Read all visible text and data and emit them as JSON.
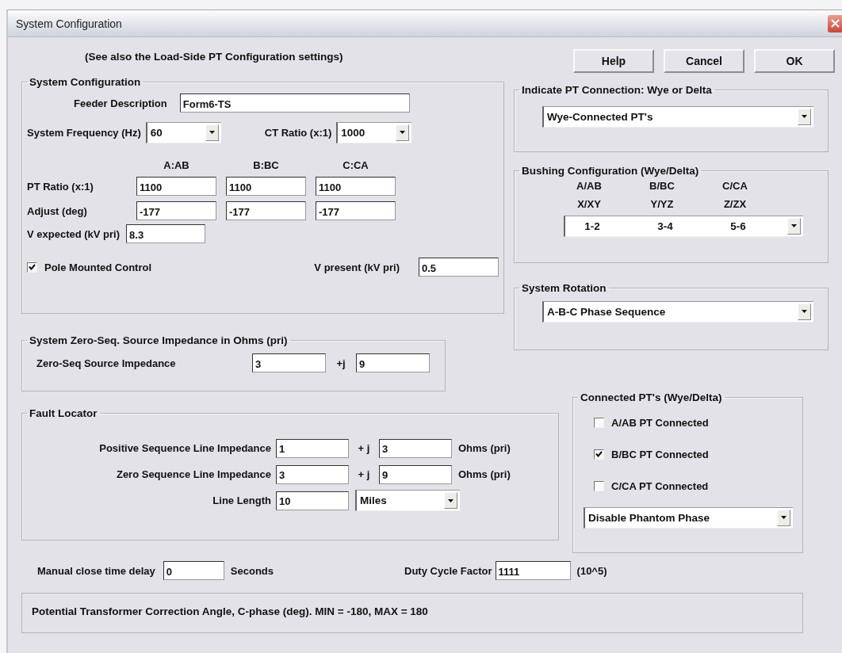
{
  "window": {
    "title": "System Configuration"
  },
  "note": "(See also the Load-Side PT Configuration settings)",
  "buttons": [
    "Help",
    "Cancel",
    "OK"
  ],
  "system_configuration": {
    "title": "System Configuration",
    "feeder_description": {
      "label": "Feeder Description",
      "value": "Form6-TS"
    },
    "system_frequency": {
      "label": "System Frequency (Hz)",
      "value": "60"
    },
    "ct_ratio": {
      "label": "CT Ratio (x:1)",
      "value": "1000"
    },
    "phase_columns": [
      "A:AB",
      "B:BC",
      "C:CA"
    ],
    "rows": [
      {
        "label": "PT Ratio (x:1)",
        "values": [
          "1100",
          "1100",
          "1100"
        ]
      },
      {
        "label": "Adjust (deg)",
        "values": [
          "-177",
          "-177",
          "-177"
        ]
      }
    ],
    "v_expected": {
      "label": "V expected (kV pri)",
      "value": "8.3"
    },
    "pole_mounted": {
      "label": "Pole Mounted Control",
      "checked": true
    },
    "v_present": {
      "label": "V present (kV pri)",
      "value": "0.5"
    }
  },
  "zero_seq_source": {
    "title": "System Zero-Seq. Source Impedance in Ohms (pri)",
    "label": "Zero-Seq Source Impedance",
    "real": "3",
    "imag_label": "+j",
    "imag": "9"
  },
  "fault_locator": {
    "title": "Fault Locator",
    "rows": [
      {
        "label": "Positive Sequence Line Impedance",
        "real": "1",
        "imag_label": "+ j",
        "imag": "3",
        "unit": "Ohms (pri)"
      },
      {
        "label": "Zero Sequence Line Impedance",
        "real": "3",
        "imag_label": "+ j",
        "imag": "9",
        "unit": "Ohms (pri)"
      }
    ],
    "line_length": {
      "label": "Line Length",
      "value": "10",
      "unit": "Miles"
    }
  },
  "pt_connection": {
    "title": "Indicate PT Connection: Wye or Delta",
    "value": "Wye-Connected PT's"
  },
  "bushing": {
    "title": "Bushing Configuration (Wye/Delta)",
    "columns": [
      {
        "phase": "A/AB",
        "terminal": "X/XY",
        "value": "1-2"
      },
      {
        "phase": "B/BC",
        "terminal": "Y/YZ",
        "value": "3-4"
      },
      {
        "phase": "C/CA",
        "terminal": "Z/ZX",
        "value": "5-6"
      }
    ]
  },
  "rotation": {
    "title": "System Rotation",
    "value": "A-B-C Phase Sequence"
  },
  "connected_pts": {
    "title": "Connected PT's (Wye/Delta)",
    "items": [
      {
        "label": "A/AB PT Connected",
        "checked": false
      },
      {
        "label": "B/BC PT Connected",
        "checked": true
      },
      {
        "label": "C/CA PT Connected",
        "checked": false
      }
    ],
    "phantom": "Disable Phantom Phase"
  },
  "manual_close": {
    "label": "Manual close time delay",
    "value": "0",
    "unit": "Seconds"
  },
  "duty_cycle": {
    "label": "Duty Cycle Factor",
    "value": "1111",
    "unit": "(10^5)"
  },
  "status": "Potential Transformer Correction Angle, C-phase (deg). MIN = -180, MAX = 180"
}
